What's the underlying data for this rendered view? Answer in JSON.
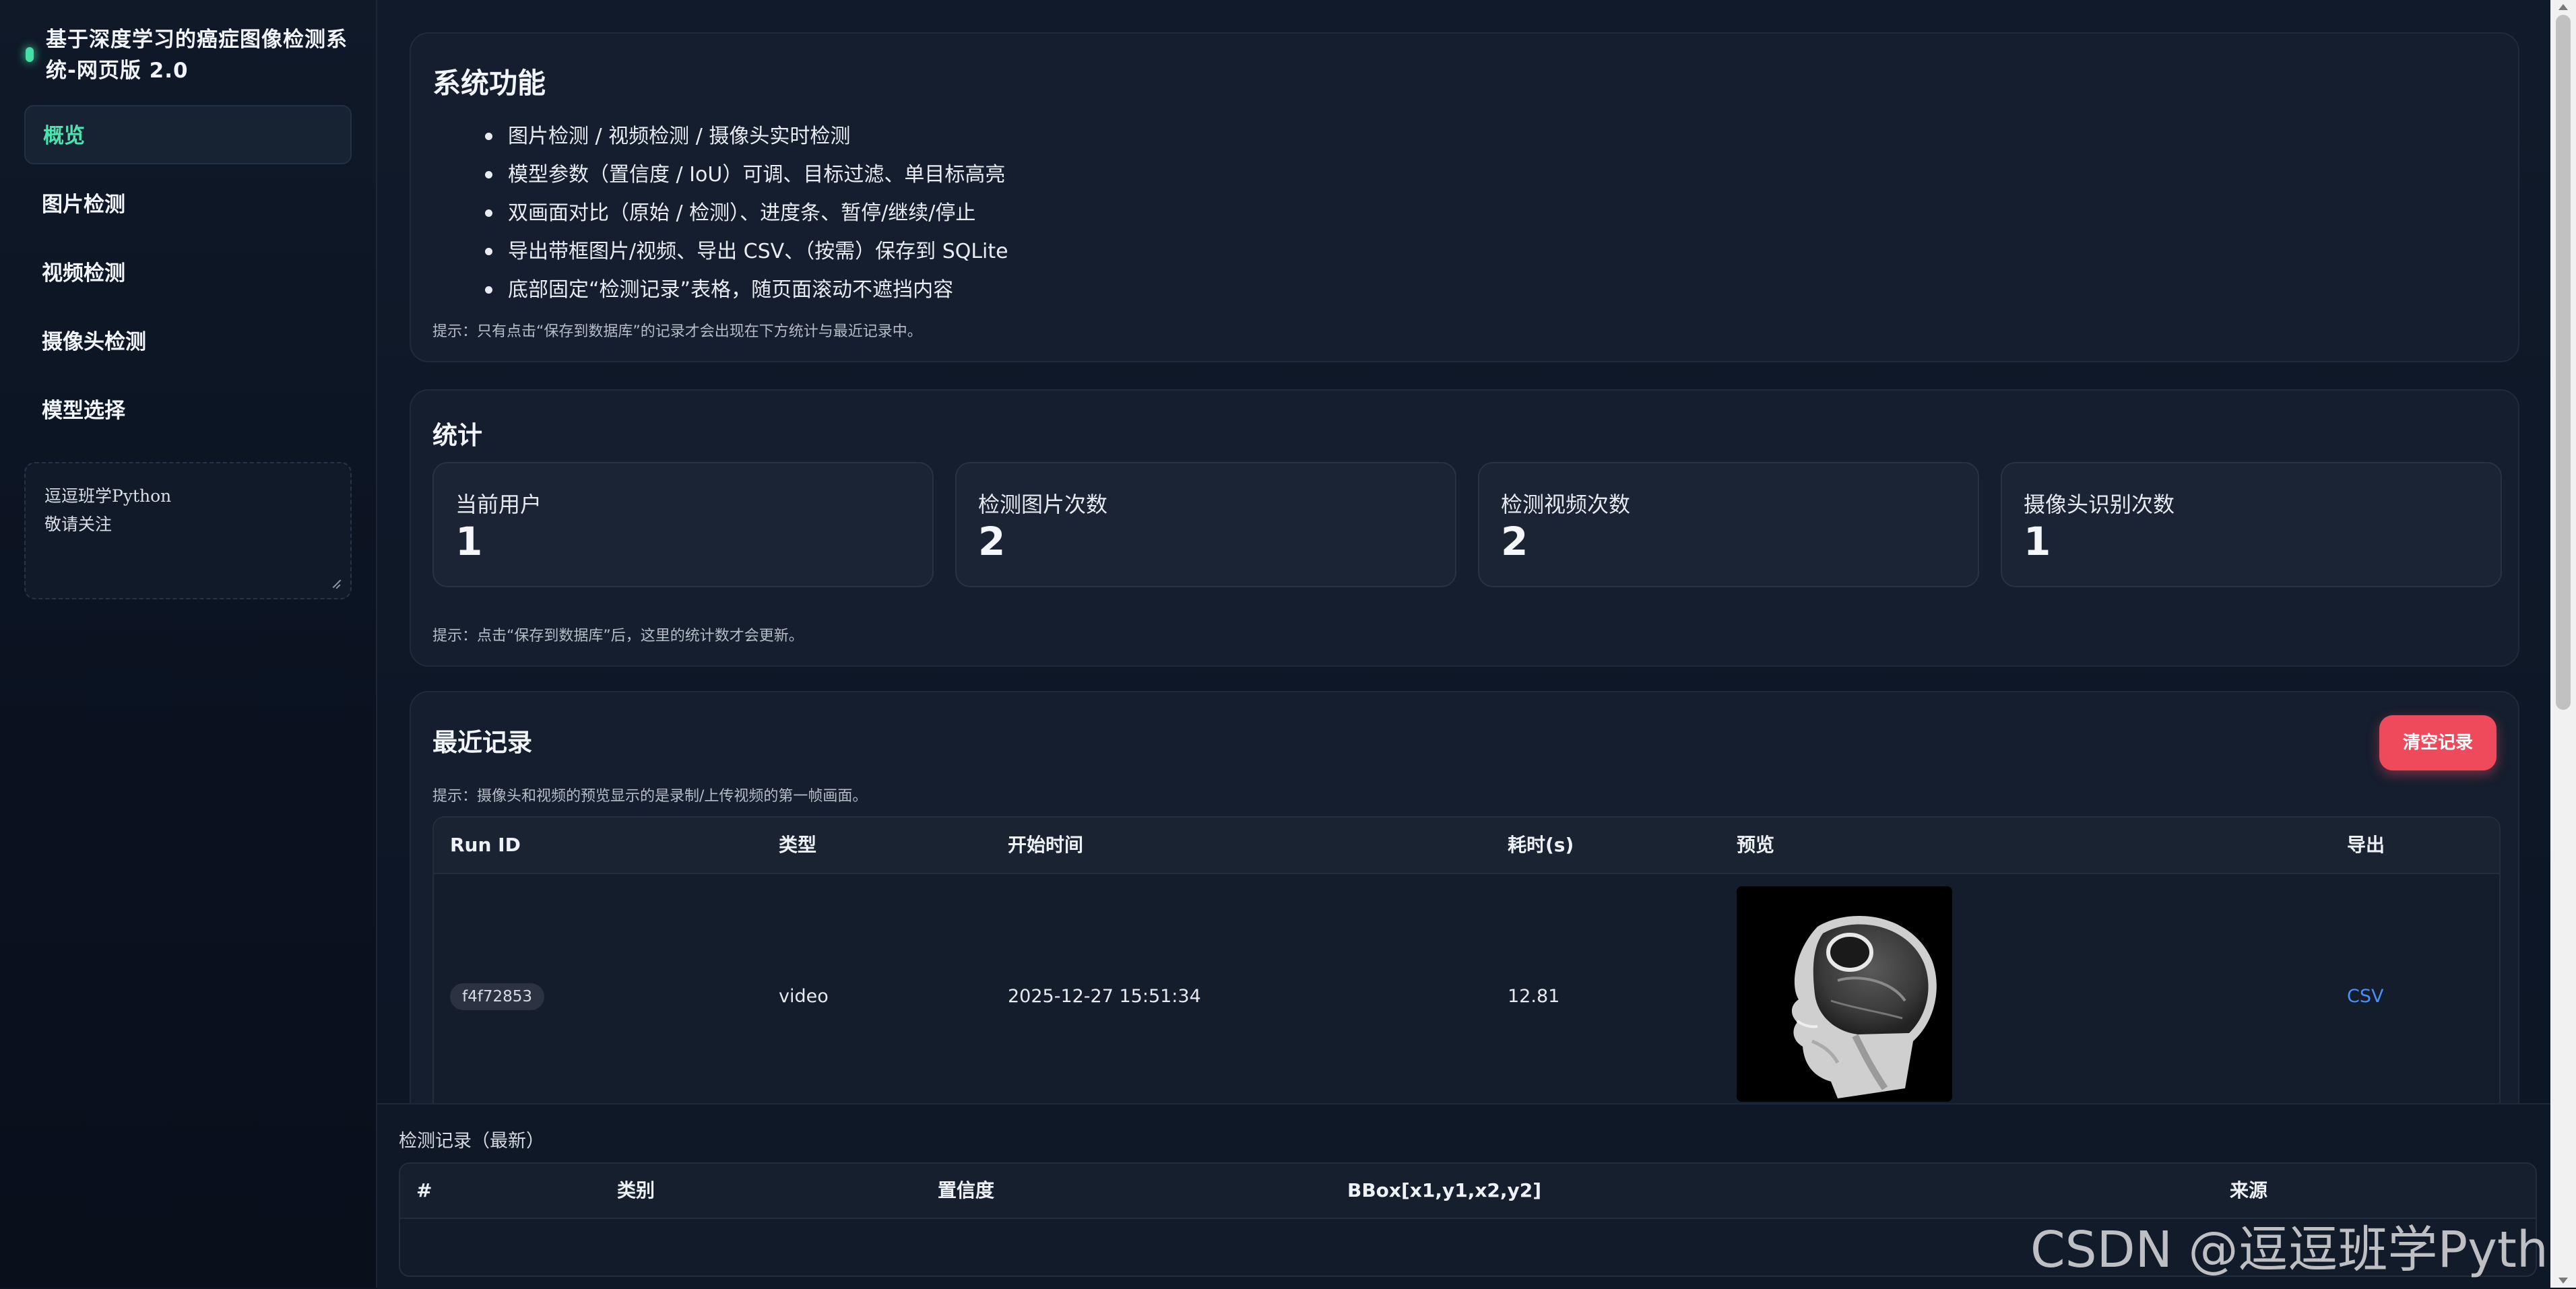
{
  "sidebar": {
    "title": "基于深度学习的癌症图像检测系统-网页版 2.0",
    "nav": [
      {
        "label": "概览"
      },
      {
        "label": "图片检测"
      },
      {
        "label": "视频检测"
      },
      {
        "label": "摄像头检测"
      },
      {
        "label": "模型选择"
      }
    ],
    "note": {
      "line1": "逗逗班学Python",
      "line2": "敬请关注"
    }
  },
  "features": {
    "title": "系统功能",
    "items": [
      "图片检测 / 视频检测 / 摄像头实时检测",
      "模型参数（置信度 / IoU）可调、目标过滤、单目标高亮",
      "双画面对比（原始 / 检测）、进度条、暂停/继续/停止",
      "导出带框图片/视频、导出 CSV、（按需）保存到 SQLite",
      "底部固定“检测记录”表格，随页面滚动不遮挡内容"
    ],
    "hint": "提示：只有点击“保存到数据库”的记录才会出现在下方统计与最近记录中。"
  },
  "stats": {
    "title": "统计",
    "cards": [
      {
        "label": "当前用户",
        "value": "1"
      },
      {
        "label": "检测图片次数",
        "value": "2"
      },
      {
        "label": "检测视频次数",
        "value": "2"
      },
      {
        "label": "摄像头识别次数",
        "value": "1"
      }
    ],
    "hint": "提示：点击“保存到数据库”后，这里的统计数才会更新。"
  },
  "recent": {
    "title": "最近记录",
    "clear_label": "清空记录",
    "hint": "提示：摄像头和视频的预览显示的是录制/上传视频的第一帧画面。",
    "columns": [
      "Run ID",
      "类型",
      "开始时间",
      "耗时(s)",
      "预览",
      "导出"
    ],
    "rows": [
      {
        "run_id": "f4f72853",
        "type": "video",
        "start": "2025-12-27 15:51:34",
        "duration": "12.81",
        "export": "CSV"
      }
    ]
  },
  "detections": {
    "title": "检测记录（最新）",
    "columns": [
      "#",
      "类别",
      "置信度",
      "BBox[x1,y1,x2,y2]",
      "来源"
    ]
  },
  "watermark": "CSDN @逗逗班学Python",
  "colors": {
    "accent_green": "#46e0a6",
    "danger_red": "#ef4a5b",
    "link_blue": "#4c8ef7"
  }
}
